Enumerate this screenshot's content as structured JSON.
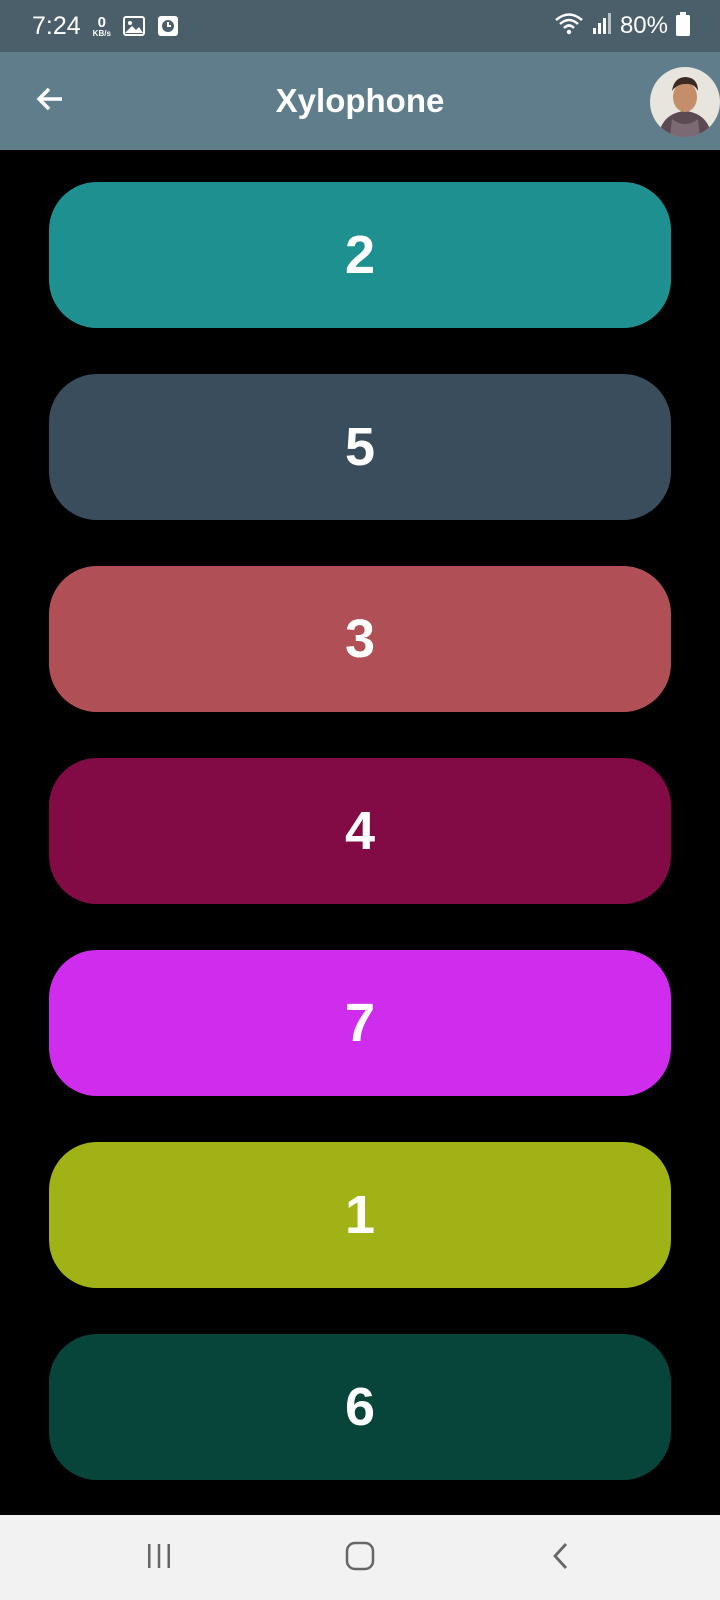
{
  "status_bar": {
    "time": "7:24",
    "net_speed_value": "0",
    "net_speed_unit": "KB/s",
    "battery": "80%",
    "icons": [
      "image-icon",
      "clock-app-icon",
      "wifi-icon",
      "signal-icon",
      "battery-icon"
    ]
  },
  "app_bar": {
    "title": "Xylophone",
    "back_icon": "arrow-left-icon",
    "avatar": "user-avatar"
  },
  "keys": [
    {
      "label": "2",
      "color": "#1e9090"
    },
    {
      "label": "5",
      "color": "#3a4d5d"
    },
    {
      "label": "3",
      "color": "#b04f55"
    },
    {
      "label": "4",
      "color": "#820b45"
    },
    {
      "label": "7",
      "color": "#d02ced"
    },
    {
      "label": "1",
      "color": "#a0b215"
    },
    {
      "label": "6",
      "color": "#07453a"
    }
  ],
  "colors": {
    "status_bar": "#4a5f6a",
    "app_bar": "#607d8b",
    "background": "#000000",
    "nav_bar": "#f2f2f2"
  },
  "nav_bar": {
    "icons": [
      "recent-apps-icon",
      "home-icon",
      "back-icon"
    ]
  }
}
